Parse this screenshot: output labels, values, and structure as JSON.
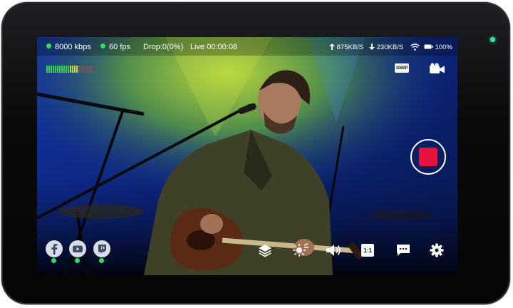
{
  "status": {
    "bitrate": "8000 kbps",
    "fps": "60 fps",
    "drop": "Drop:0(0%)",
    "live": "Live 00:00:08",
    "upload": "875KB/S",
    "download": "230KB/S",
    "battery": "100%"
  },
  "toolbar": {
    "resolution_badge": "1080P",
    "aspect_label": "1:1"
  },
  "audio_meter": {
    "level": 0.7,
    "segments": 22
  },
  "social": [
    "facebook",
    "youtube",
    "twitch"
  ],
  "colors": {
    "status_green": "#2ee05a",
    "record_red": "#e8123c",
    "camera_led": "#39e2a0"
  },
  "icons": [
    "wifi-icon",
    "battery-icon",
    "upload-arrow-icon",
    "download-arrow-icon",
    "video-camera-icon",
    "layers-icon",
    "image-adjust-icon",
    "speaker-icon",
    "chat-icon",
    "gear-icon"
  ]
}
